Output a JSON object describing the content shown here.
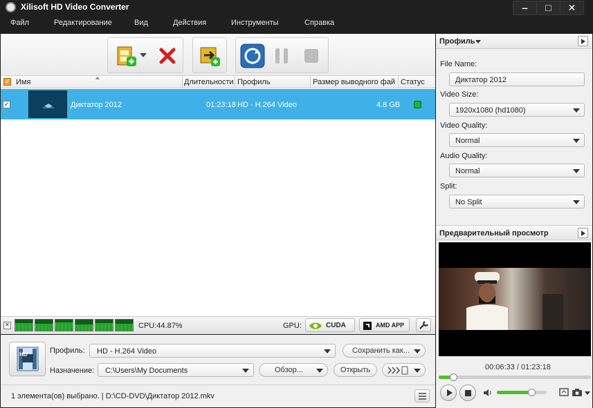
{
  "window": {
    "title": "Xilisoft HD Video Converter",
    "minimize": "‒",
    "maximize": "□",
    "close": "✕"
  },
  "menu": [
    "Файл",
    "Редактирование",
    "Вид",
    "Действия",
    "Инструменты",
    "Справка"
  ],
  "toolbar": {
    "add_file_icon": "film-add-icon",
    "remove_icon": "red-x-icon",
    "add_output_icon": "film-export-icon",
    "convert_icon": "convert-refresh-icon",
    "pause_icon": "pause-icon",
    "stop_icon": "stop-icon"
  },
  "columns": {
    "name": "Имя",
    "duration": "Длительности",
    "profile": "Профиль",
    "output_size": "Размер выводного фай",
    "status": "Статус"
  },
  "rows": [
    {
      "checked": "✓",
      "name": "Диктатор 2012",
      "duration": "01:23:18",
      "profile": "HD - H.264 Video",
      "size": "4.8 GB",
      "status_color": "#19b43a"
    }
  ],
  "gpu_bar": {
    "cpu": "CPU:44.87%",
    "gpu_label": "GPU:",
    "cuda": "CUDA",
    "amd": "AMD APP"
  },
  "bottom": {
    "profile_label": "Профиль:",
    "profile_value": "HD - H.264 Video",
    "save_as": "Сохранить как...",
    "dest_label": "Назначение:",
    "dest_value": "C:\\Users\\My Documents",
    "browse": "Обзор...",
    "open": "Открыть",
    "hd_badge": "HD",
    "status_text": "1 элемента(ов) выбрано. | D:\\CD-DVD\\Диктатор 2012.mkv"
  },
  "profile_panel": {
    "title": "Профиль",
    "file_name_label": "File Name:",
    "file_name": "Диктатор 2012",
    "video_size_label": "Video Size:",
    "video_size": "1920x1080 (hd1080)",
    "video_quality_label": "Video Quality:",
    "video_quality": "Normal",
    "audio_quality_label": "Audio Quality:",
    "audio_quality": "Normal",
    "split_label": "Split:",
    "split": "No Split"
  },
  "preview": {
    "title": "Предварительный просмотр",
    "time": "00:06:33 / 01:23:18",
    "seek_progress": 0.08,
    "volume_level": 0.7
  }
}
